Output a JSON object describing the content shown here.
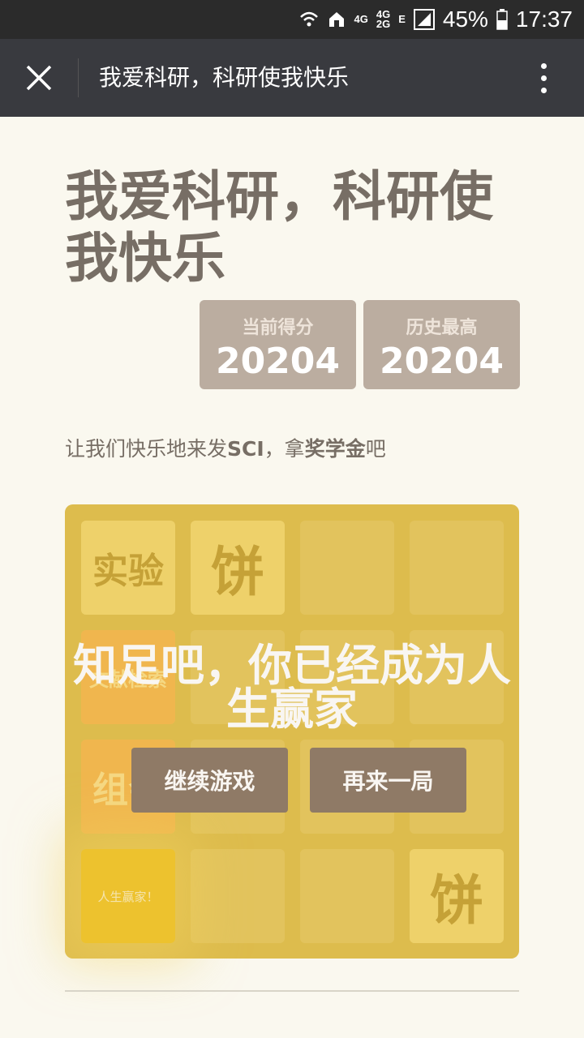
{
  "status_bar": {
    "battery_percent": "45%",
    "time": "17:37",
    "net_a": "4G",
    "net_b": "4G",
    "net_c": "2G",
    "net_e": "E",
    "icons": [
      "wifi-icon",
      "home-icon",
      "signal-icon",
      "battery-icon"
    ]
  },
  "titlebar": {
    "title": "我爱科研，科研使我快乐",
    "icons": [
      "close-icon",
      "more-icon"
    ]
  },
  "game": {
    "heading": "我爱科研，科研使我快乐",
    "scores": {
      "current_label": "当前得分",
      "current_value": "20204",
      "best_label": "历史最高",
      "best_value": "20204"
    },
    "intro": {
      "part1": "让我们快乐地来发",
      "bold1": "SCI",
      "part2": "，拿",
      "bold2": "奖学金",
      "part3": "吧"
    },
    "tiles": {
      "r0c0": "实验",
      "r0c1": "饼",
      "r1c0": "文献检索",
      "r2c0": "组会",
      "r3c0": "人生赢家！",
      "r3c3": "饼"
    },
    "overlay": {
      "message": "知足吧，你已经成为人生赢家",
      "continue_label": "继续游戏",
      "restart_label": "再来一局"
    }
  },
  "colors": {
    "title_bar": "#393a3f",
    "board": "#d4b85e",
    "button": "#8f7a66",
    "score_box": "#bbada0"
  }
}
